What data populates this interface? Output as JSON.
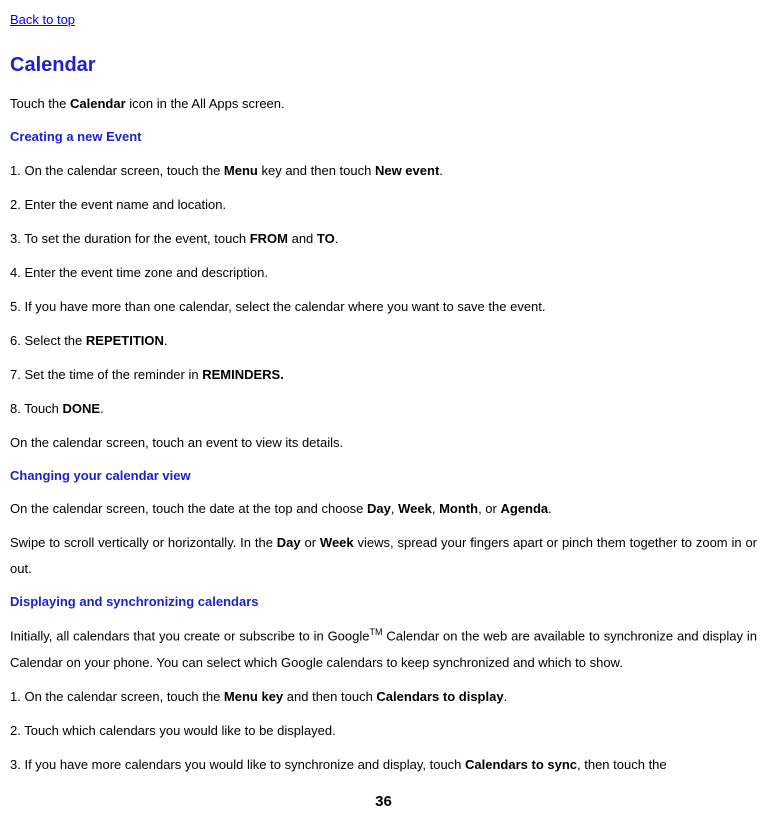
{
  "backLink": "Back to top",
  "title": "Calendar",
  "intro": {
    "t1": "Touch the ",
    "b1": "Calendar",
    "t2": " icon in the All Apps screen."
  },
  "h_create": "Creating a new Event",
  "step1": {
    "t1": "1. On the calendar screen, touch the ",
    "b1": "Menu",
    "t2": " key and then touch ",
    "b2": "New event",
    "t3": "."
  },
  "step2": "2. Enter the event name and location.",
  "step3": {
    "t1": "3. To set the duration for the event, touch ",
    "b1": "FROM",
    "t2": " and ",
    "b2": "TO",
    "t3": "."
  },
  "step4": "4. Enter the event time zone and description.",
  "step5": "5. If you have more than one calendar, select the calendar where you want to save the event.",
  "step6": {
    "t1": "6. Select the ",
    "b1": "REPETITION",
    "t2": "."
  },
  "step7": {
    "t1": "7. Set the time of the reminder in ",
    "b1": "REMINDERS."
  },
  "step8": {
    "t1": "8. Touch ",
    "b1": "DONE",
    "t2": "."
  },
  "afterSteps": "On the calendar screen, touch an event to view its details.",
  "h_changing": "Changing your calendar view",
  "changing1": {
    "t1": "On the calendar screen, touch the date at the top and choose ",
    "b1": "Day",
    "t2": ", ",
    "b2": "Week",
    "t3": ", ",
    "b3": "Month",
    "t4": ", or ",
    "b4": "Agenda",
    "t5": "."
  },
  "changing2": {
    "t1": "Swipe to scroll vertically or horizontally. In the ",
    "b1": "Day",
    "t2": " or ",
    "b2": "Week",
    "t3": " views, spread your fingers apart or pinch them together to zoom in or out."
  },
  "h_display": "Displaying and synchronizing calendars",
  "display_intro": {
    "t1": "Initially, all calendars that you create or subscribe to in Google",
    "sup": "TM",
    "t2": " Calendar on the web are available to synchronize and display in Calendar on your phone. You can select which Google calendars to keep synchronized and which to show."
  },
  "dstep1": {
    "t1": "1. On the calendar screen, touch the ",
    "b1": "Menu key",
    "t2": " and then touch ",
    "b2": "Calendars to display",
    "t3": "."
  },
  "dstep2": "2. Touch which calendars you would like to be displayed.",
  "dstep3": {
    "t1": "3. If you have more calendars you would like to synchronize and display, touch ",
    "b1": "Calendars to sync",
    "t2": ", then touch the"
  },
  "pageNum": "36"
}
